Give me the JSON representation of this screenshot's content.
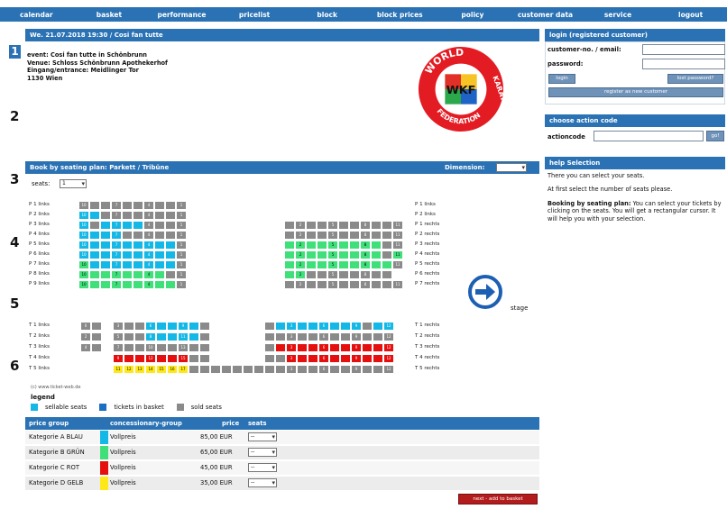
{
  "nav": [
    "calendar",
    "basket",
    "performance",
    "pricelist",
    "block",
    "block prices",
    "policy",
    "customer data",
    "service",
    "logout"
  ],
  "event_bar": "We. 21.07.2018 19:30 / Cosi fan tutte",
  "event": {
    "title": "event: Cosi fan tutte in Schönbrunn",
    "venue": "Venue: Schloss Schönbrunn Apothekerhof",
    "entrance": "Eingang/entrance: Meidlinger Tor",
    "city": "1130 Wien"
  },
  "logo": {
    "top": "WORLD",
    "right": "KARATE",
    "bottom": "FEDERATION",
    "center": "WKF",
    "colors": [
      "#e03027",
      "#1f63c6",
      "#2aa84a",
      "#f7c325"
    ]
  },
  "booking": {
    "title": "Book by seating plan: Parkett / Tribüne",
    "dimension_label": "Dimension:",
    "seats_label": "seats:",
    "seats_value": "1"
  },
  "numbers": [
    "1",
    "2",
    "3",
    "4",
    "5",
    "6"
  ],
  "left_rows": [
    "P 1 links",
    "P 2 links",
    "P 3 links",
    "P 4 links",
    "P 5 links",
    "P 6 links",
    "P 7 links",
    "P 8 links",
    "P 9 links"
  ],
  "right_rows": [
    "P 1 links",
    "P 2 links",
    "P 1 rechts",
    "P 2 rechts",
    "P 3 rechts",
    "P 4 rechts",
    "P 5 rechts",
    "P 6 rechts",
    "P 7 rechts"
  ],
  "t_left_rows": [
    "T 1 links",
    "T 2 links",
    "T 3 links",
    "T 4 links",
    "T 5 links"
  ],
  "t_right_rows": [
    "T 1 rechts",
    "T 2 rechts",
    "T 3 rechts",
    "T 4 rechts",
    "T 5 rechts"
  ],
  "stage_label": "stage",
  "powered": "(c) www.ticket-web.de",
  "legend": {
    "title": "legend",
    "items": [
      "sellable seats",
      "tickets in basket",
      "sold seats"
    ],
    "colors": [
      "#13b8e6",
      "#1a6fc0",
      "#8a8a8a"
    ]
  },
  "price_table": {
    "headers": [
      "price group",
      "concessionary-group",
      "price",
      "seats"
    ],
    "rows": [
      {
        "group": "Kategorie A BLAU",
        "conc": "Vollpreis",
        "price": "85,00 EUR",
        "seats": "--",
        "color": "#13b8e6"
      },
      {
        "group": "Kategorie B GRÜN",
        "conc": "Vollpreis",
        "price": "65,00 EUR",
        "seats": "--",
        "color": "#3fe07a"
      },
      {
        "group": "Kategorie C ROT",
        "conc": "Vollpreis",
        "price": "45,00 EUR",
        "seats": "--",
        "color": "#e60f0f"
      },
      {
        "group": "Kategorie D GELB",
        "conc": "Vollpreis",
        "price": "35,00 EUR",
        "seats": "--",
        "color": "#ffe81a"
      }
    ]
  },
  "add_button": "next - add to basket",
  "login": {
    "title": "login (registered customer)",
    "customer_label": "customer-no. / email:",
    "password_label": "password:",
    "login_btn": "login",
    "lost_btn": "lost password?",
    "register_btn": "register as new customer"
  },
  "action": {
    "title": "choose action code",
    "label": "actioncode",
    "go": "go!"
  },
  "help": {
    "title": "help Selection",
    "p1": "There you can select your seats.",
    "p2": "At first select the number of seats please.",
    "p3_bold": "Booking by seating plan:",
    "p3": " You can select your tickets by clicking on the seats. You will get a rectangular cursor. It will help you with your selection."
  }
}
